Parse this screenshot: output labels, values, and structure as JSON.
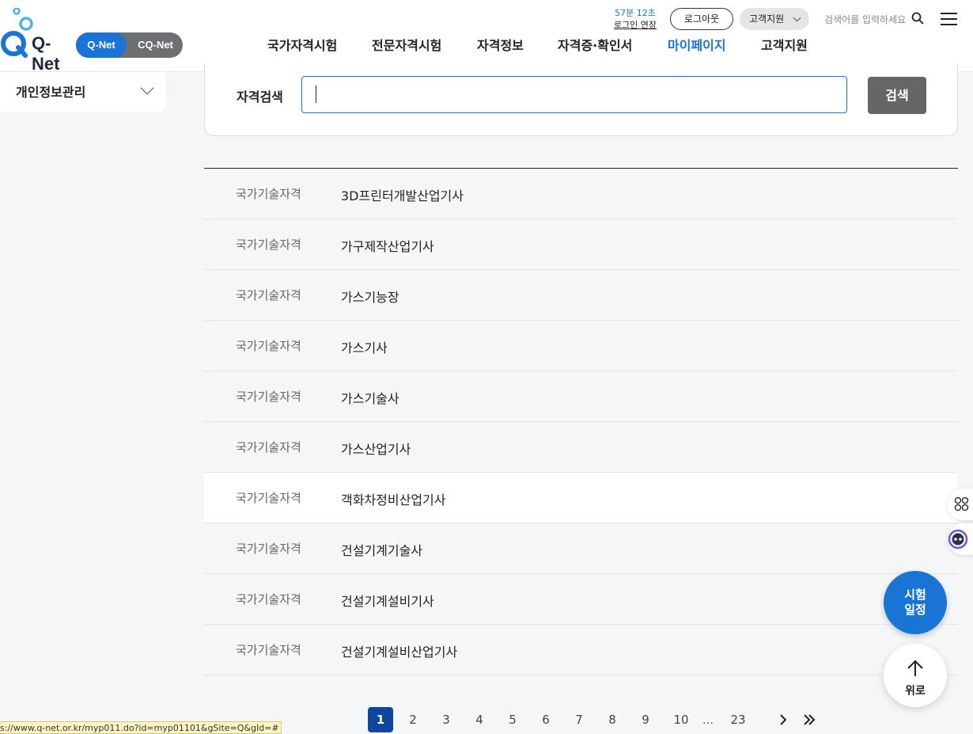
{
  "header": {
    "logo_text": "Q-Net",
    "site_tabs": [
      "Q-Net",
      "CQ-Net"
    ],
    "session_time": "57분 12초",
    "session_extend": "로그인 연장",
    "logout": "로그아웃",
    "support": "고객지원",
    "search_placeholder": "검색어를 입력하세요",
    "nav": [
      "국가자격시험",
      "전문자격시험",
      "자격정보",
      "자격증·확인서",
      "마이페이지",
      "고객지원"
    ]
  },
  "sidebar": {
    "label": "개인정보관리"
  },
  "search": {
    "label": "자격검색",
    "value": "",
    "button": "검색"
  },
  "results": [
    {
      "category": "국가기술자격",
      "name": "3D프린터개발산업기사"
    },
    {
      "category": "국가기술자격",
      "name": "가구제작산업기사"
    },
    {
      "category": "국가기술자격",
      "name": "가스기능장"
    },
    {
      "category": "국가기술자격",
      "name": "가스기사"
    },
    {
      "category": "국가기술자격",
      "name": "가스기술사"
    },
    {
      "category": "국가기술자격",
      "name": "가스산업기사"
    },
    {
      "category": "국가기술자격",
      "name": "객화차정비산업기사"
    },
    {
      "category": "국가기술자격",
      "name": "건설기계기술사"
    },
    {
      "category": "국가기술자격",
      "name": "건설기계설비기사"
    },
    {
      "category": "국가기술자격",
      "name": "건설기계설비산업기사"
    }
  ],
  "pagination": {
    "pages": [
      "1",
      "2",
      "3",
      "4",
      "5",
      "6",
      "7",
      "8",
      "9",
      "10"
    ],
    "current": "1",
    "ellipsis": "...",
    "last": "23"
  },
  "floating": {
    "schedule_line1": "시험",
    "schedule_line2": "일정",
    "top": "위로"
  },
  "status_url": "s://www.q-net.or.kr/myp011.do?id=myp01101&gSite=Q&gId=#",
  "colors": {
    "accent": "#1a74d6",
    "page_active": "#0d47a1"
  }
}
